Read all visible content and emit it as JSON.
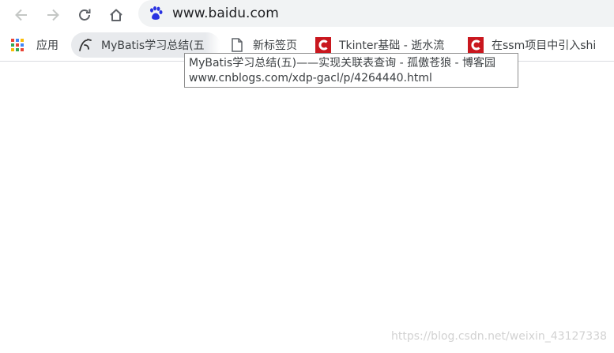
{
  "omnibox": {
    "url": "www.baidu.com",
    "site_icon": "baidu-paw-icon"
  },
  "nav": {
    "back_icon": "back-arrow-icon",
    "forward_icon": "forward-arrow-icon",
    "reload_icon": "reload-icon",
    "home_icon": "home-icon"
  },
  "bookmarks": {
    "apps_label": "应用",
    "items": [
      {
        "label": "MyBatis学习总结(五",
        "icon": "cnblogs-icon"
      },
      {
        "label": "新标签页",
        "icon": "page-icon"
      },
      {
        "label": "Tkinter基础 - 逝水流",
        "icon": "csdn-icon"
      },
      {
        "label": "在ssm项目中引入shi",
        "icon": "csdn-icon"
      }
    ]
  },
  "tooltip": {
    "title": "MyBatis学习总结(五)——实现关联表查询 - 孤傲苍狼 - 博客园",
    "url": "www.cnblogs.com/xdp-gacl/p/4264440.html"
  },
  "watermark": "https://blog.csdn.net/weixin_43127338",
  "colors": {
    "omnibox_bg": "#f1f3f4",
    "bookmark_hover_bg": "#e8eaed",
    "csdn_red": "#c9171e",
    "baidu_blue": "#2932e1"
  }
}
